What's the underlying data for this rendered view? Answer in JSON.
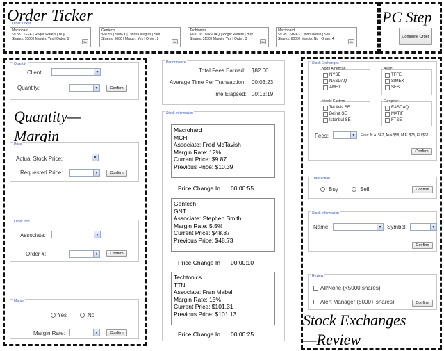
{
  "annotations": {
    "order_ticker": "Order Ticker",
    "pc_step": "PC Step",
    "quantity_margin_1": "Quantity—",
    "quantity_margin_2": "Margin",
    "stock_exchanges_review_1": "Stock Exchanges",
    "stock_exchanges_review_2": "—Review"
  },
  "order_ticker": {
    "group_title": "Order Ticker",
    "items": [
      {
        "company": "Macrohard",
        "line1": "$9.88 | TFFE | Roger Waters | Buy",
        "line2": "Shares: 1000 | Margin: Yes | Order: 5",
        "button": "5s"
      },
      {
        "company": "Gentech",
        "line1": "$50.50 | SIMEX | Didas Douglas | Sell",
        "line2": "Shares: 5000 | Margin: Yes | Order: 2",
        "button": "5s"
      },
      {
        "company": "Techtonics",
        "line1": "$100.16 | NASDAQ | Roger Waters | Buy",
        "line2": "Shares: 3150 | Margin: Yes | Order: 3",
        "button": "5s"
      },
      {
        "company": "Macrohard",
        "line1": "$9.95 | SIMEX | John Doslin | Sell",
        "line2": "Shares: 6000 | Margin: No | Order: 4",
        "button": "5s"
      }
    ]
  },
  "pc_step": {
    "complete_button": "Complete Order"
  },
  "quantity": {
    "group_title": "Quantity",
    "client_label": "Client:",
    "quantity_label": "Quantity:",
    "confirm": "Confirm"
  },
  "price": {
    "group_title": "Price",
    "actual_label": "Actual Stock Price:",
    "requested_label": "Requested Price:",
    "confirm": "Confirm"
  },
  "order_info": {
    "group_title": "Order Info",
    "associate_label": "Associate:",
    "order_label": "Order #:",
    "confirm": "Confirm"
  },
  "margin": {
    "group_title": "Margin",
    "yes": "Yes",
    "no": "No",
    "rate_label": "Margin Rate:",
    "confirm": "Confirm"
  },
  "performance": {
    "group_title": "Performance",
    "rows": [
      {
        "label": "Total Fees Earned:",
        "value": "$82.00"
      },
      {
        "label": "Average Time Per Transaction:",
        "value": "00:03:23"
      },
      {
        "label": "Time Elapsed:",
        "value": "00:13:19"
      }
    ]
  },
  "stock_information_panel": {
    "group_title": "Stock Information",
    "stocks": [
      {
        "name": "Macrohard",
        "symbol": "MCH",
        "associate": "Associate: Fred McTavish",
        "margin_rate": "Margin Rate: 12%",
        "current": "Current Price: $9.87",
        "previous": "Previous Price: $10.39",
        "change_label": "Price Change In",
        "change_time": "00:00:55"
      },
      {
        "name": "Gentech",
        "symbol": "GNT",
        "associate": "Associate: Stephen Smith",
        "margin_rate": "Margin Rate: 5.5%",
        "current": "Current Price: $48.87",
        "previous": "Previous Price: $48.73",
        "change_label": "Price Change In",
        "change_time": "00:00:10"
      },
      {
        "name": "Techtonics",
        "symbol": "TTN",
        "associate": "Associate: Fran Mabel",
        "margin_rate": "Margin Rate: 15%",
        "current": "Current Price: $101.31",
        "previous": "Previous Price: $101.13",
        "change_label": "Price Change In",
        "change_time": "00:00:25"
      }
    ]
  },
  "stock_exchanges": {
    "group_title": "Stock Exchanges",
    "regions": [
      {
        "name": "North American",
        "items": [
          "NYSE",
          "NASDAQ",
          "AMEX"
        ]
      },
      {
        "name": "Asian",
        "items": [
          "TFFE",
          "SIMEX",
          "SES"
        ]
      },
      {
        "name": "Middle Eastern",
        "items": [
          "Tel Aviv SE",
          "Beirut SE",
          "Istanbul SE"
        ]
      },
      {
        "name": "European",
        "items": [
          "EASDAQ",
          "MATIF",
          "FTSE"
        ]
      }
    ],
    "fees_label": "Fees:",
    "fees_note": "Fees: N.A. $67, Asia $58, M.E. $75, EU $62",
    "confirm": "Confirm"
  },
  "transaction": {
    "group_title": "Transaction",
    "buy": "Buy",
    "sell": "Sell",
    "confirm": "Confirm"
  },
  "stock_info_select": {
    "group_title": "Stock Information",
    "name_label": "Name:",
    "symbol_label": "Symbol:",
    "confirm": "Confirm"
  },
  "review": {
    "group_title": "Review",
    "all_none": "All/None (<5000 shares)",
    "alert_manager": "Alert Manager (5000+ shares)",
    "confirm": "Confirm"
  }
}
